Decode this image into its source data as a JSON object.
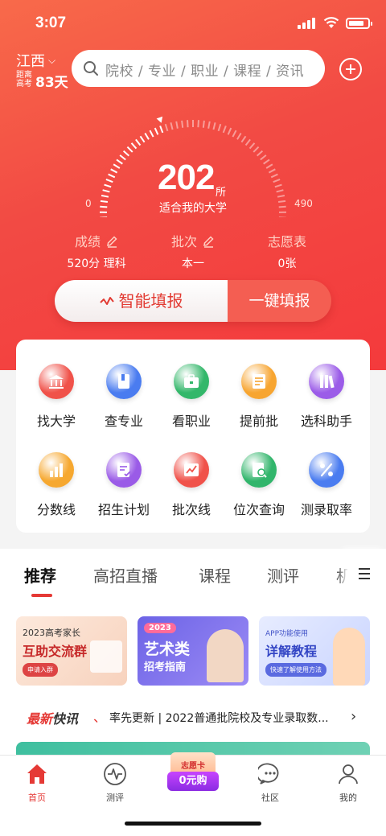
{
  "status": {
    "time": "3:07"
  },
  "header": {
    "region": "江西",
    "days_prefix_1": "距离",
    "days_prefix_2": "高考",
    "days_left": "83天",
    "search_placeholder": "院校 / 专业 / 职业 / 课程 / 资讯"
  },
  "gauge": {
    "count": "202",
    "unit": "所",
    "caption": "适合我的大学",
    "min": "0",
    "max": "490",
    "value": 202,
    "range": [
      0,
      490
    ]
  },
  "stats": [
    {
      "label": "成绩",
      "value": "520分 理科",
      "editable": true
    },
    {
      "label": "批次",
      "value": "本一",
      "editable": true
    },
    {
      "label": "志愿表",
      "value": "0张",
      "editable": false
    }
  ],
  "actions": {
    "smart": "智能填报",
    "one_click": "一键填报"
  },
  "grid": [
    {
      "label": "找大学",
      "icon": "university-icon",
      "color": "#f0524a"
    },
    {
      "label": "查专业",
      "icon": "book-icon",
      "color": "#4a7cf0"
    },
    {
      "label": "看职业",
      "icon": "briefcase-icon",
      "color": "#33b76a"
    },
    {
      "label": "提前批",
      "icon": "checklist-icon",
      "color": "#f7a531"
    },
    {
      "label": "选科助手",
      "icon": "books-icon",
      "color": "#9b5ce8"
    },
    {
      "label": "分数线",
      "icon": "bar-chart-icon",
      "color": "#f6a830"
    },
    {
      "label": "招生计划",
      "icon": "plan-icon",
      "color": "#9a5be7"
    },
    {
      "label": "批次线",
      "icon": "line-chart-icon",
      "color": "#f0524a"
    },
    {
      "label": "位次查询",
      "icon": "rank-search-icon",
      "color": "#31b56b"
    },
    {
      "label": "测录取率",
      "icon": "percent-icon",
      "color": "#4a7cf0"
    }
  ],
  "tabs": [
    "推荐",
    "高招直播",
    "课程",
    "测评",
    "机"
  ],
  "banners": [
    {
      "line1": "2023高考家长",
      "line2": "互助交流群",
      "button": "申请入群"
    },
    {
      "badge": "2023",
      "line2": "艺术类",
      "line3": "招考指南"
    },
    {
      "line1": "APP功能使用",
      "line2": "详解教程",
      "button": "快速了解使用方法"
    }
  ],
  "news": {
    "tag_red": "最新",
    "tag_dark": "快讯",
    "text": "率先更新 | 2022普通批院校及专业录取数..."
  },
  "nav": {
    "home": "首页",
    "assess": "测评",
    "promo_top": "志愿卡",
    "promo": "0元购",
    "community": "社区",
    "mine": "我的"
  },
  "colors": {
    "primary": "#f24a44",
    "accent_red": "#e53935"
  }
}
